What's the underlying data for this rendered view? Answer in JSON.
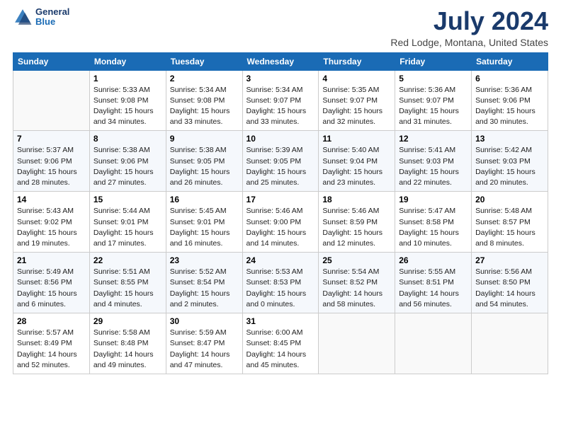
{
  "logo": {
    "line1": "General",
    "line2": "Blue"
  },
  "header": {
    "month": "July 2024",
    "location": "Red Lodge, Montana, United States"
  },
  "weekdays": [
    "Sunday",
    "Monday",
    "Tuesday",
    "Wednesday",
    "Thursday",
    "Friday",
    "Saturday"
  ],
  "weeks": [
    [
      {
        "day": "",
        "sunrise": "",
        "sunset": "",
        "daylight": ""
      },
      {
        "day": "1",
        "sunrise": "Sunrise: 5:33 AM",
        "sunset": "Sunset: 9:08 PM",
        "daylight": "Daylight: 15 hours and 34 minutes."
      },
      {
        "day": "2",
        "sunrise": "Sunrise: 5:34 AM",
        "sunset": "Sunset: 9:08 PM",
        "daylight": "Daylight: 15 hours and 33 minutes."
      },
      {
        "day": "3",
        "sunrise": "Sunrise: 5:34 AM",
        "sunset": "Sunset: 9:07 PM",
        "daylight": "Daylight: 15 hours and 33 minutes."
      },
      {
        "day": "4",
        "sunrise": "Sunrise: 5:35 AM",
        "sunset": "Sunset: 9:07 PM",
        "daylight": "Daylight: 15 hours and 32 minutes."
      },
      {
        "day": "5",
        "sunrise": "Sunrise: 5:36 AM",
        "sunset": "Sunset: 9:07 PM",
        "daylight": "Daylight: 15 hours and 31 minutes."
      },
      {
        "day": "6",
        "sunrise": "Sunrise: 5:36 AM",
        "sunset": "Sunset: 9:06 PM",
        "daylight": "Daylight: 15 hours and 30 minutes."
      }
    ],
    [
      {
        "day": "7",
        "sunrise": "Sunrise: 5:37 AM",
        "sunset": "Sunset: 9:06 PM",
        "daylight": "Daylight: 15 hours and 28 minutes."
      },
      {
        "day": "8",
        "sunrise": "Sunrise: 5:38 AM",
        "sunset": "Sunset: 9:06 PM",
        "daylight": "Daylight: 15 hours and 27 minutes."
      },
      {
        "day": "9",
        "sunrise": "Sunrise: 5:38 AM",
        "sunset": "Sunset: 9:05 PM",
        "daylight": "Daylight: 15 hours and 26 minutes."
      },
      {
        "day": "10",
        "sunrise": "Sunrise: 5:39 AM",
        "sunset": "Sunset: 9:05 PM",
        "daylight": "Daylight: 15 hours and 25 minutes."
      },
      {
        "day": "11",
        "sunrise": "Sunrise: 5:40 AM",
        "sunset": "Sunset: 9:04 PM",
        "daylight": "Daylight: 15 hours and 23 minutes."
      },
      {
        "day": "12",
        "sunrise": "Sunrise: 5:41 AM",
        "sunset": "Sunset: 9:03 PM",
        "daylight": "Daylight: 15 hours and 22 minutes."
      },
      {
        "day": "13",
        "sunrise": "Sunrise: 5:42 AM",
        "sunset": "Sunset: 9:03 PM",
        "daylight": "Daylight: 15 hours and 20 minutes."
      }
    ],
    [
      {
        "day": "14",
        "sunrise": "Sunrise: 5:43 AM",
        "sunset": "Sunset: 9:02 PM",
        "daylight": "Daylight: 15 hours and 19 minutes."
      },
      {
        "day": "15",
        "sunrise": "Sunrise: 5:44 AM",
        "sunset": "Sunset: 9:01 PM",
        "daylight": "Daylight: 15 hours and 17 minutes."
      },
      {
        "day": "16",
        "sunrise": "Sunrise: 5:45 AM",
        "sunset": "Sunset: 9:01 PM",
        "daylight": "Daylight: 15 hours and 16 minutes."
      },
      {
        "day": "17",
        "sunrise": "Sunrise: 5:46 AM",
        "sunset": "Sunset: 9:00 PM",
        "daylight": "Daylight: 15 hours and 14 minutes."
      },
      {
        "day": "18",
        "sunrise": "Sunrise: 5:46 AM",
        "sunset": "Sunset: 8:59 PM",
        "daylight": "Daylight: 15 hours and 12 minutes."
      },
      {
        "day": "19",
        "sunrise": "Sunrise: 5:47 AM",
        "sunset": "Sunset: 8:58 PM",
        "daylight": "Daylight: 15 hours and 10 minutes."
      },
      {
        "day": "20",
        "sunrise": "Sunrise: 5:48 AM",
        "sunset": "Sunset: 8:57 PM",
        "daylight": "Daylight: 15 hours and 8 minutes."
      }
    ],
    [
      {
        "day": "21",
        "sunrise": "Sunrise: 5:49 AM",
        "sunset": "Sunset: 8:56 PM",
        "daylight": "Daylight: 15 hours and 6 minutes."
      },
      {
        "day": "22",
        "sunrise": "Sunrise: 5:51 AM",
        "sunset": "Sunset: 8:55 PM",
        "daylight": "Daylight: 15 hours and 4 minutes."
      },
      {
        "day": "23",
        "sunrise": "Sunrise: 5:52 AM",
        "sunset": "Sunset: 8:54 PM",
        "daylight": "Daylight: 15 hours and 2 minutes."
      },
      {
        "day": "24",
        "sunrise": "Sunrise: 5:53 AM",
        "sunset": "Sunset: 8:53 PM",
        "daylight": "Daylight: 15 hours and 0 minutes."
      },
      {
        "day": "25",
        "sunrise": "Sunrise: 5:54 AM",
        "sunset": "Sunset: 8:52 PM",
        "daylight": "Daylight: 14 hours and 58 minutes."
      },
      {
        "day": "26",
        "sunrise": "Sunrise: 5:55 AM",
        "sunset": "Sunset: 8:51 PM",
        "daylight": "Daylight: 14 hours and 56 minutes."
      },
      {
        "day": "27",
        "sunrise": "Sunrise: 5:56 AM",
        "sunset": "Sunset: 8:50 PM",
        "daylight": "Daylight: 14 hours and 54 minutes."
      }
    ],
    [
      {
        "day": "28",
        "sunrise": "Sunrise: 5:57 AM",
        "sunset": "Sunset: 8:49 PM",
        "daylight": "Daylight: 14 hours and 52 minutes."
      },
      {
        "day": "29",
        "sunrise": "Sunrise: 5:58 AM",
        "sunset": "Sunset: 8:48 PM",
        "daylight": "Daylight: 14 hours and 49 minutes."
      },
      {
        "day": "30",
        "sunrise": "Sunrise: 5:59 AM",
        "sunset": "Sunset: 8:47 PM",
        "daylight": "Daylight: 14 hours and 47 minutes."
      },
      {
        "day": "31",
        "sunrise": "Sunrise: 6:00 AM",
        "sunset": "Sunset: 8:45 PM",
        "daylight": "Daylight: 14 hours and 45 minutes."
      },
      {
        "day": "",
        "sunrise": "",
        "sunset": "",
        "daylight": ""
      },
      {
        "day": "",
        "sunrise": "",
        "sunset": "",
        "daylight": ""
      },
      {
        "day": "",
        "sunrise": "",
        "sunset": "",
        "daylight": ""
      }
    ]
  ]
}
